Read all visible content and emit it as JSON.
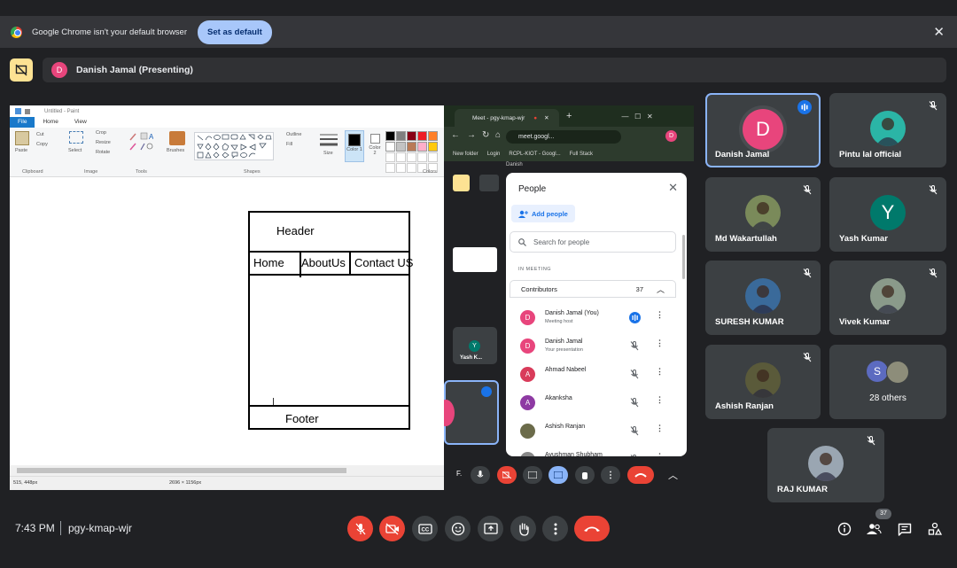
{
  "notification": {
    "message": "Google Chrome isn't your default browser",
    "set_default": "Set as default",
    "close": "✕"
  },
  "presenting": {
    "avatar_letter": "D",
    "label": "Danish Jamal (Presenting)"
  },
  "paint": {
    "title": "Untitled - Paint",
    "tabs": [
      "File",
      "Home",
      "View"
    ],
    "ribbon": {
      "paste": "Paste",
      "cut": "Cut",
      "copy": "Copy",
      "select": "Select",
      "crop": "Crop",
      "resize": "Resize",
      "rotate": "Rotate",
      "brushes": "Brushes",
      "outline": "Outline",
      "fill": "Fill",
      "size": "Size",
      "color1": "Color 1",
      "color2": "Color 2",
      "groups": [
        "Clipboard",
        "Image",
        "Tools",
        "Shapes",
        "Colors"
      ]
    },
    "palette": [
      "#000000",
      "#7f7f7f",
      "#880015",
      "#ed1c24",
      "#ff7f27",
      "#ffffff",
      "#c3c3c3",
      "#b97a57",
      "#ffaec9",
      "#ffc90e"
    ],
    "status": {
      "cursor": "515, 448px",
      "size": "2696 × 1156px"
    },
    "wireframe": {
      "header": "Header",
      "nav": [
        "Home",
        "AboutUs",
        "Contact US"
      ],
      "footer": "Footer"
    }
  },
  "meet_window": {
    "tab_title": "Meet - pgy-kmap-wjr",
    "url": "meet.googl...",
    "bookmarks": [
      "New folder",
      "Login",
      "RCPL-KIOT - Googl...",
      "Full Stack"
    ],
    "peek_name": "Danish",
    "yash_label": "Yash K...",
    "yash_letter": "Y",
    "bottom_initial": "F.",
    "people": {
      "title": "People",
      "add": "Add people",
      "search_placeholder": "Search for people",
      "in_meeting": "IN MEETING",
      "contributors": "Contributors",
      "count": "37",
      "rows": [
        {
          "name": "Danish Jamal (You)",
          "sub": "Meeting host",
          "letter": "D",
          "color": "#e8457c"
        },
        {
          "name": "Danish Jamal",
          "sub": "Your presentation",
          "letter": "D",
          "color": "#e8457c"
        },
        {
          "name": "Ahmad Nabeel",
          "sub": "",
          "letter": "A",
          "color": "#d93b5a"
        },
        {
          "name": "Akanksha",
          "sub": "",
          "letter": "A",
          "color": "#8e3aa3"
        },
        {
          "name": "Ashish Ranjan",
          "sub": "",
          "letter": "",
          "color": "#6b6b4a"
        },
        {
          "name": "Ayushman Shubham",
          "sub": "",
          "letter": "",
          "color": "#888888"
        }
      ]
    }
  },
  "tiles": [
    {
      "name": "Danish Jamal",
      "letter": "D",
      "color": "#e8457c",
      "speaking": true
    },
    {
      "name": "Pintu lal official",
      "letter": "",
      "color": "#2bb5a6",
      "speaking": false
    },
    {
      "name": "Md Wakartullah",
      "letter": "",
      "color": "#7a8a5a",
      "speaking": false
    },
    {
      "name": "Yash Kumar",
      "letter": "Y",
      "color": "#00796b",
      "speaking": false
    },
    {
      "name": "SURESH KUMAR",
      "letter": "",
      "color": "#3a6a9a",
      "speaking": false
    },
    {
      "name": "Vivek Kumar",
      "letter": "",
      "color": "#8a9a8a",
      "speaking": false
    },
    {
      "name": "Ashish Ranjan",
      "letter": "",
      "color": "#5a5a3a",
      "speaking": false
    },
    {
      "name": "28 others",
      "letter": "S",
      "color": "#5c6bc0",
      "speaking": false
    },
    {
      "name": "RAJ KUMAR",
      "letter": "",
      "color": "#9aa6b2",
      "speaking": false
    }
  ],
  "bottom": {
    "time": "7:43 PM",
    "meeting_code": "pgy-kmap-wjr",
    "participant_count": "37"
  },
  "colors": {
    "accent": "#8ab4f8",
    "danger": "#ea4335",
    "tile_bg": "#3c4043",
    "page_bg": "#202124"
  }
}
